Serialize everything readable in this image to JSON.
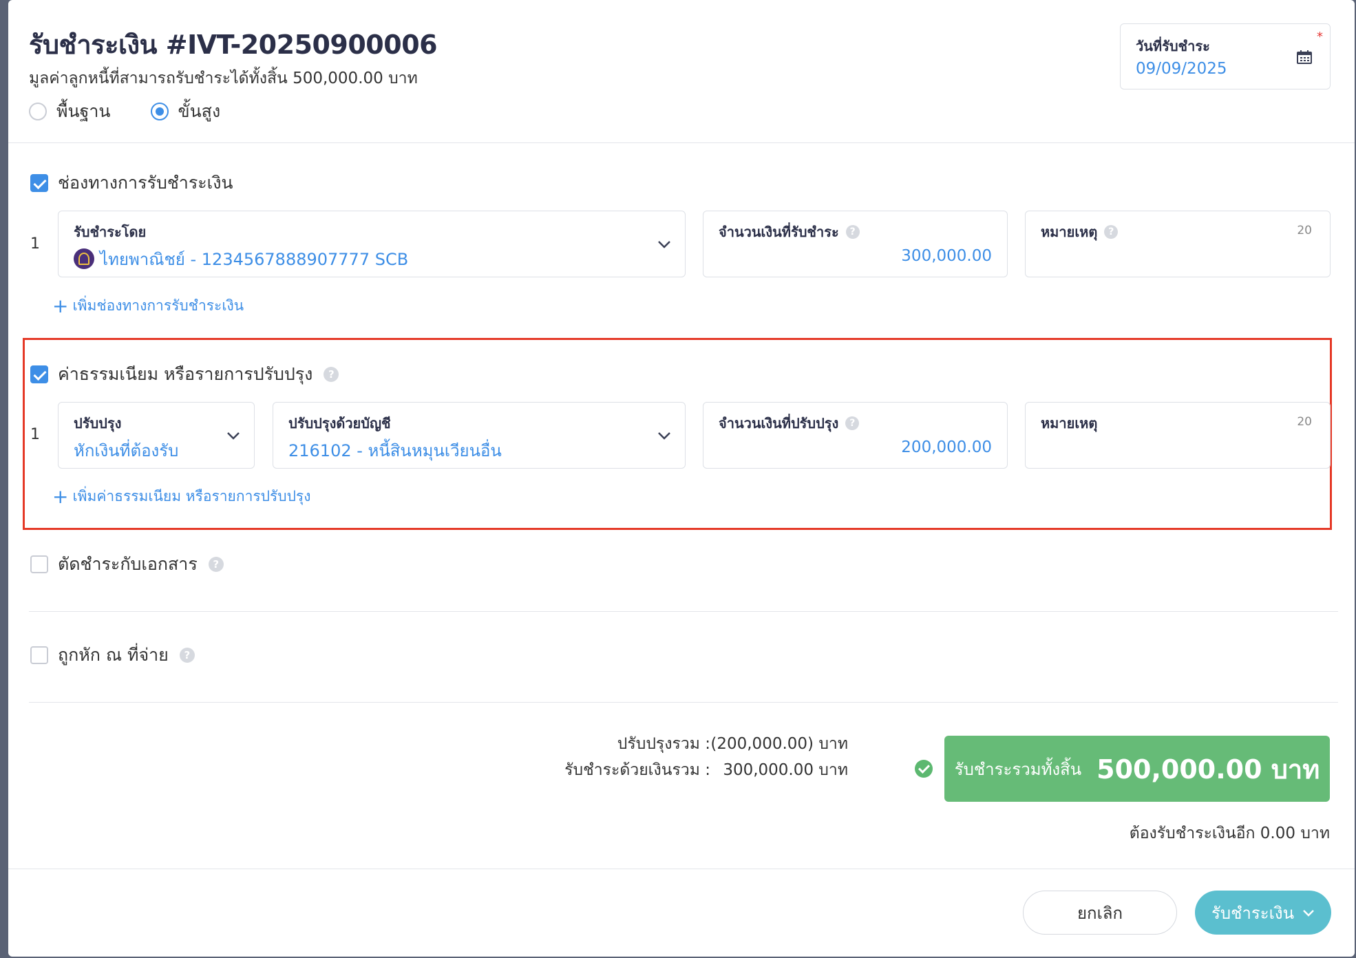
{
  "header": {
    "title": "รับชำระเงิน #IVT-20250900006",
    "subtitle": "มูลค่าลูกหนี้ที่สามารถรับชำระได้ทั้งสิ้น 500,000.00 บาท",
    "mode_options": [
      {
        "label": "พื้นฐาน",
        "selected": false
      },
      {
        "label": "ขั้นสูง",
        "selected": true
      }
    ],
    "date_field": {
      "label": "วันที่รับชำระ",
      "required_mark": "*",
      "value": "09/09/2025",
      "icon": "calendar-icon"
    }
  },
  "payment_channel": {
    "checked": true,
    "label": "ช่องทางการรับชำระเงิน",
    "rows": [
      {
        "index": "1",
        "receive_by_label": "รับชำระโดย",
        "receive_by_value": "ไทยพาณิชย์ - 1234567888907777 SCB",
        "amount_label": "จำนวนเงินที่รับชำระ",
        "amount_value": "300,000.00",
        "note_label": "หมายเหตุ",
        "note_counter": "20"
      }
    ],
    "add_label": "เพิ่มช่องทางการรับชำระเงิน"
  },
  "fees": {
    "checked": true,
    "label": "ค่าธรรมเนียม หรือรายการปรับปรุง",
    "rows": [
      {
        "index": "1",
        "adjust_label": "ปรับปรุง",
        "adjust_value": "หักเงินที่ต้องรับ",
        "account_label": "ปรับปรุงด้วยบัญชี",
        "account_value": "216102 - หนี้สินหมุนเวียนอื่น",
        "amount_label": "จำนวนเงินที่ปรับปรุง",
        "amount_value": "200,000.00",
        "note_label": "หมายเหตุ",
        "note_counter": "20"
      }
    ],
    "add_label": "เพิ่มค่าธรรมเนียม หรือรายการปรับปรุง"
  },
  "settle_docs": {
    "checked": false,
    "label": "ตัดชำระกับเอกสาร"
  },
  "withholding": {
    "checked": false,
    "label": "ถูกหัก ณ ที่จ่าย"
  },
  "summary": {
    "adjust_total_label": "ปรับปรุงรวม :",
    "adjust_total_value": "(200,000.00) บาท",
    "cash_total_label": "รับชำระด้วยเงินรวม :",
    "cash_total_value": "300,000.00 บาท",
    "grand_label": "รับชำระรวมทั้งสิ้น",
    "grand_value": "500,000.00 บาท",
    "remaining": "ต้องรับชำระเงินอีก 0.00 บาท"
  },
  "footer": {
    "cancel_label": "ยกเลิก",
    "submit_label": "รับชำระเงิน"
  },
  "colors": {
    "accent": "#3d8ee6",
    "success": "#66bb77",
    "submit": "#5bbfcf",
    "highlight_border": "#e53927"
  }
}
